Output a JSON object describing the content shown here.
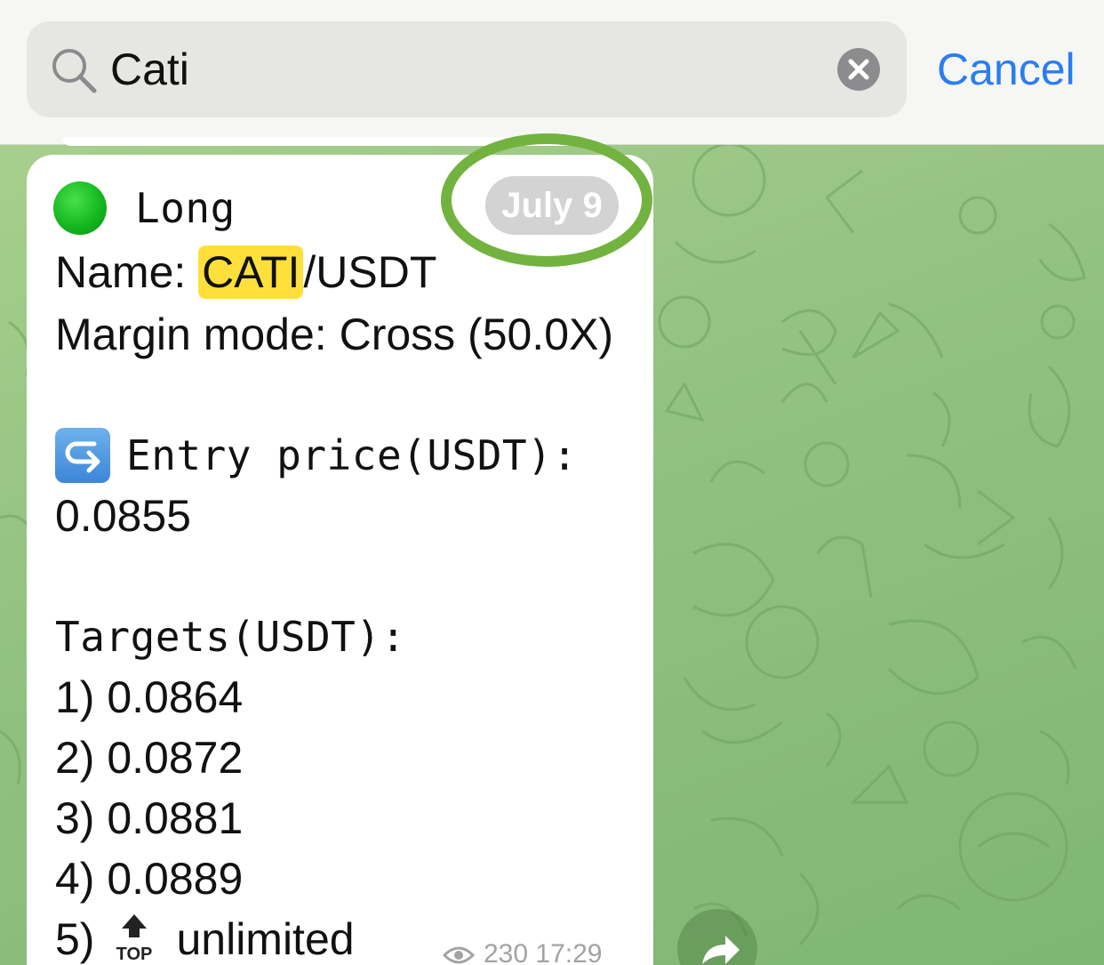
{
  "search": {
    "value": "Cati",
    "cancel_label": "Cancel"
  },
  "message": {
    "date_label": "July 9",
    "signal_label": "Long",
    "name_prefix": "Name: ",
    "name_highlight": "CATI",
    "name_suffix": "/USDT",
    "margin_mode": "Margin mode: Cross (50.0X)",
    "entry_label": "Entry price(USDT):",
    "entry_value": "0.0855",
    "targets_label": "Targets(USDT):",
    "targets": [
      "1) 0.0864",
      "2) 0.0872",
      "3) 0.0881",
      "4) 0.0889"
    ],
    "target5_prefix": "5)",
    "target5_value": "unlimited",
    "top_icon_text": "TOP",
    "views": "230",
    "time": "17:29"
  },
  "colors": {
    "accent": "#2a7ef0",
    "highlight": "#ffe03a",
    "ring": "#72b33f",
    "signal_dot": "#15b81f"
  },
  "icons": {
    "search": "search-icon",
    "clear": "clear-icon",
    "entry": "right-arrow-curving-left-icon",
    "top": "top-arrow-icon",
    "views": "eye-icon",
    "share": "share-icon"
  }
}
